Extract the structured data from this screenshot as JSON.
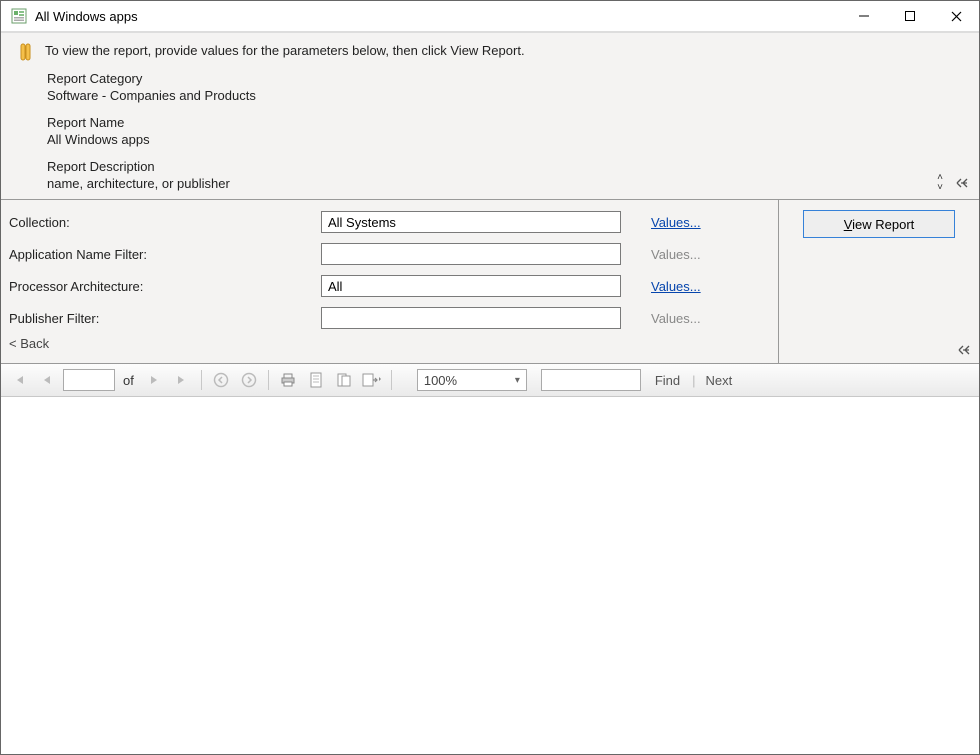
{
  "window": {
    "title": "All Windows apps"
  },
  "info": {
    "instruction": "To view the report, provide values for the parameters below, then click View Report.",
    "category_label": "Report Category",
    "category_value": "Software - Companies and Products",
    "name_label": "Report Name",
    "name_value": "All Windows apps",
    "desc_label": "Report Description",
    "desc_value": "name, architecture, or publisher"
  },
  "params": {
    "rows": [
      {
        "label": "Collection:",
        "value": "All Systems",
        "link": "Values...",
        "link_enabled": true
      },
      {
        "label": "Application Name Filter:",
        "value": "",
        "link": "Values...",
        "link_enabled": false
      },
      {
        "label": "Processor Architecture:",
        "value": "All",
        "link": "Values...",
        "link_enabled": true
      },
      {
        "label": "Publisher Filter:",
        "value": "",
        "link": "Values...",
        "link_enabled": false
      }
    ],
    "back": "< Back",
    "view_report_prefix": "V",
    "view_report_rest": "iew Report"
  },
  "toolbar": {
    "of": "of",
    "zoom": "100%",
    "find": "Find",
    "next": "Next",
    "page_value": "",
    "find_value": ""
  }
}
